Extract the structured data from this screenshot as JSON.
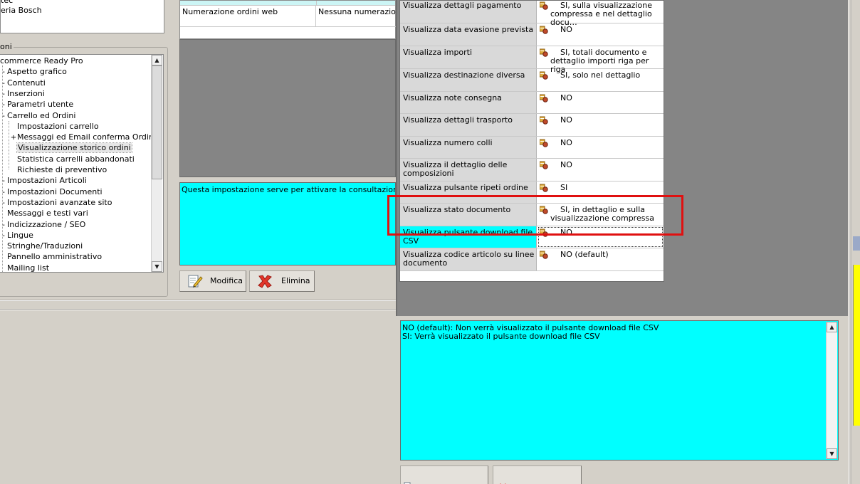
{
  "left_list": {
    "items": [
      "tec",
      "eria Bosch"
    ]
  },
  "group": {
    "label": "oni"
  },
  "tree": {
    "items": [
      {
        "label": "commerce Ready Pro",
        "level": 0,
        "expander": ""
      },
      {
        "label": "Aspetto grafico",
        "level": 1,
        "expander": "-"
      },
      {
        "label": "Contenuti",
        "level": 1,
        "expander": "-"
      },
      {
        "label": "Inserzioni",
        "level": 1,
        "expander": "-"
      },
      {
        "label": "Parametri utente",
        "level": 1,
        "expander": "-"
      },
      {
        "label": "Carrello ed Ordini",
        "level": 1,
        "expander": "-"
      },
      {
        "label": "Impostazioni carrello",
        "level": 2,
        "expander": ""
      },
      {
        "label": "Messaggi ed Email conferma Ordine",
        "level": 2,
        "expander": "+"
      },
      {
        "label": "Visualizzazione storico ordini",
        "level": 2,
        "expander": "",
        "selected": true
      },
      {
        "label": "Statistica carrelli abbandonati",
        "level": 2,
        "expander": ""
      },
      {
        "label": "Richieste di preventivo",
        "level": 2,
        "expander": ""
      },
      {
        "label": "Impostazioni Articoli",
        "level": 1,
        "expander": "-"
      },
      {
        "label": "Impostazioni Documenti",
        "level": 1,
        "expander": "-"
      },
      {
        "label": "Impostazioni avanzate sito",
        "level": 1,
        "expander": "-"
      },
      {
        "label": "Messaggi e testi vari",
        "level": 1,
        "expander": ""
      },
      {
        "label": "Indicizzazione / SEO",
        "level": 1,
        "expander": "-"
      },
      {
        "label": "Lingue",
        "level": 1,
        "expander": "-"
      },
      {
        "label": "Stringhe/Traduzioni",
        "level": 1,
        "expander": ""
      },
      {
        "label": "Pannello amministrativo",
        "level": 1,
        "expander": ""
      },
      {
        "label": "Mailing list",
        "level": 1,
        "expander": ""
      }
    ]
  },
  "mid_table": {
    "row_name": "Numerazione ordini web",
    "row_value": "Nessuna numerazione ("
  },
  "mid_description": "Questa impostazione serve per attivare la consultazione degli ordi",
  "buttons": {
    "modifica": "Modifica",
    "elimina": "Elimina"
  },
  "grid": {
    "rows": [
      {
        "name": "Visualizza dettagli pagamento",
        "value": "SI, sulla visualizzazione compressa e nel dettaglio docu…"
      },
      {
        "name": "Visualizza data evasione prevista",
        "value": "NO"
      },
      {
        "name": "Visualizza importi",
        "value": "SI, totali documento e dettaglio importi riga per riga"
      },
      {
        "name": "Visualizza destinazione diversa",
        "value": "SI, solo nel dettaglio"
      },
      {
        "name": "Visualizza note consegna",
        "value": "NO"
      },
      {
        "name": "Visualizza dettagli trasporto",
        "value": "NO"
      },
      {
        "name": "Visualizza numero colli",
        "value": "NO"
      },
      {
        "name": "Visualizza il dettaglio delle composizioni",
        "value": "NO"
      },
      {
        "name": "Visualizza pulsante ripeti ordine",
        "value": "SI"
      },
      {
        "name": "Visualizza stato documento",
        "value": "SI, in dettaglio e sulla visualizzazione compressa"
      },
      {
        "name": "Visualizza pulsante download file CSV",
        "value": "NO",
        "current": true
      },
      {
        "name": "Visualizza codice articolo su linee documento",
        "value": "NO (default)"
      }
    ]
  },
  "bottom_description": {
    "lines": [
      "NO (default): Non verrà visualizzato il pulsante download file CSV",
      "SI: Verrà visualizzato il pulsante download file CSV"
    ]
  },
  "colors": {
    "description_bg": "#00ffff",
    "highlight": "#e01010",
    "panel_gray": "#858585"
  }
}
